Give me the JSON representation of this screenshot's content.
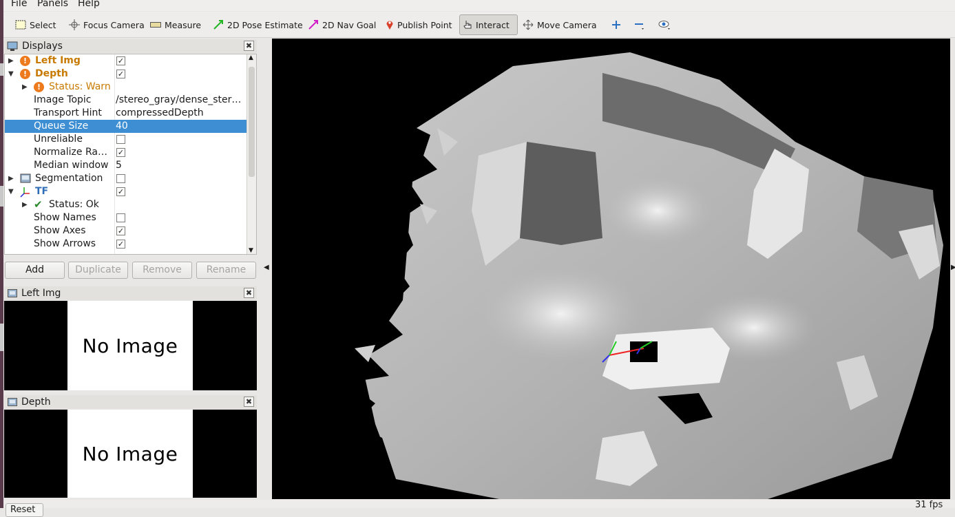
{
  "menu": {
    "file": "File",
    "panels": "Panels",
    "help": "Help"
  },
  "toolbar": {
    "select": "Select",
    "focus_camera": "Focus Camera",
    "measure": "Measure",
    "pose_estimate": "2D Pose Estimate",
    "nav_goal": "2D Nav Goal",
    "publish_point": "Publish Point",
    "interact": "Interact",
    "move_camera": "Move Camera"
  },
  "displays_panel": {
    "title": "Displays",
    "rows": [
      {
        "label": "Left Img",
        "checked": true
      },
      {
        "label": "Depth",
        "checked": true
      },
      {
        "label": "Status: Warn"
      },
      {
        "label": "Image Topic",
        "value": "/stereo_gray/dense_ster…"
      },
      {
        "label": "Transport Hint",
        "value": "compressedDepth"
      },
      {
        "label": "Queue Size",
        "value": "40"
      },
      {
        "label": "Unreliable",
        "checked": false
      },
      {
        "label": "Normalize Ra…",
        "checked": true
      },
      {
        "label": "Median window",
        "value": "5"
      },
      {
        "label": "Segmentation",
        "checked": false
      },
      {
        "label": "TF",
        "checked": true
      },
      {
        "label": "Status: Ok"
      },
      {
        "label": "Show Names",
        "checked": false
      },
      {
        "label": "Show Axes",
        "checked": true
      },
      {
        "label": "Show Arrows",
        "checked": true
      }
    ],
    "checkmark": "✓",
    "buttons": {
      "add": "Add",
      "duplicate": "Duplicate",
      "remove": "Remove",
      "rename": "Rename"
    }
  },
  "left_img_panel": {
    "title": "Left Img",
    "message": "No Image"
  },
  "depth_panel": {
    "title": "Depth",
    "message": "No Image"
  },
  "status": {
    "reset": "Reset",
    "fps": "31 fps"
  },
  "colors": {
    "warn": "#ee7a1e",
    "selection": "#3d8ed3",
    "tf_blue": "#2e6db8"
  }
}
